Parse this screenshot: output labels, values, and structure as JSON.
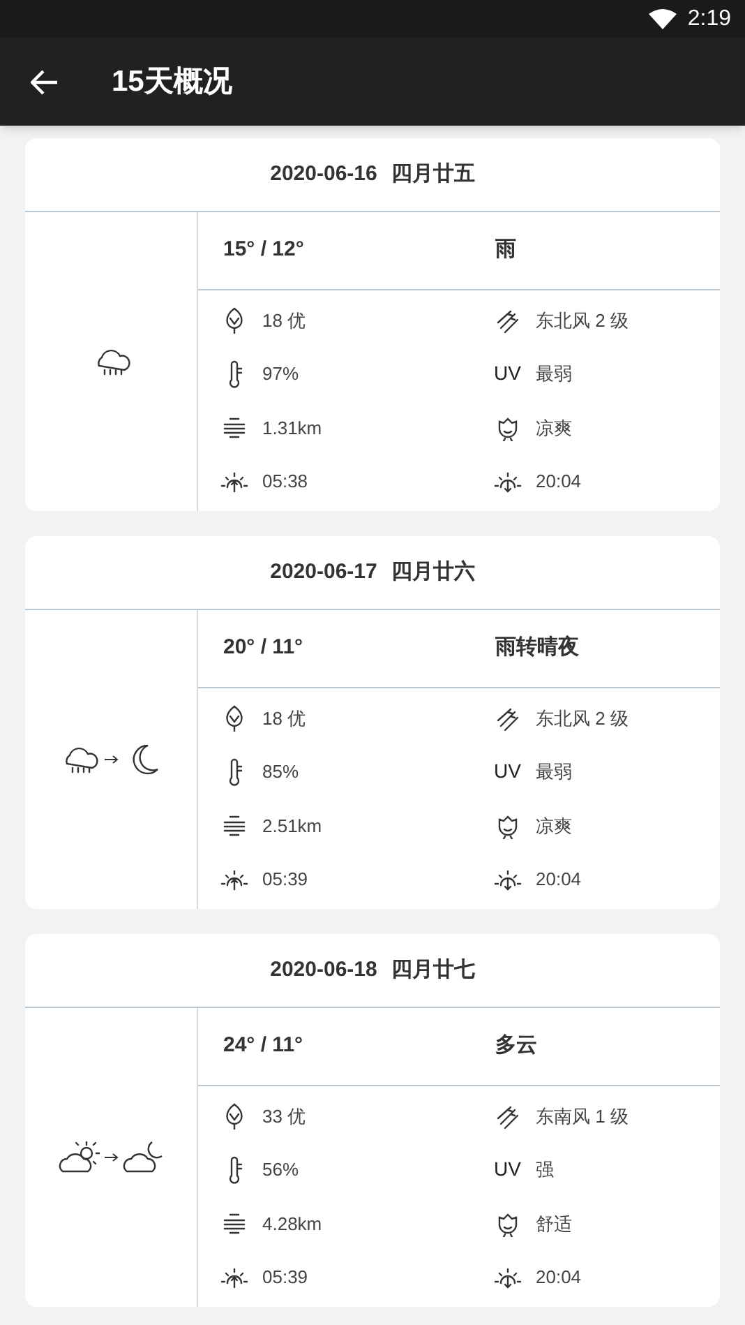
{
  "status_bar": {
    "time": "2:19"
  },
  "app_bar": {
    "title": "15天概况"
  },
  "days": [
    {
      "date": "2020-06-16",
      "lunar": "四月廿五",
      "weather_icons": [
        {
          "kind": "rain"
        }
      ],
      "temps": "15° / 12°",
      "condition": "雨",
      "details": [
        {
          "kind": "aqi",
          "value": "18 优"
        },
        {
          "kind": "wind",
          "value": "东北风 2 级"
        },
        {
          "kind": "humidity",
          "value": "97%"
        },
        {
          "kind": "uv",
          "label": "UV",
          "value": "最弱"
        },
        {
          "kind": "visibility",
          "value": "1.31km"
        },
        {
          "kind": "comfort",
          "value": "凉爽"
        },
        {
          "kind": "sunrise",
          "value": "05:38"
        },
        {
          "kind": "sunset",
          "value": "20:04"
        }
      ]
    },
    {
      "date": "2020-06-17",
      "lunar": "四月廿六",
      "weather_icons": [
        {
          "kind": "rain"
        },
        {
          "kind": "moon"
        }
      ],
      "temps": "20° / 11°",
      "condition": "雨转晴夜",
      "details": [
        {
          "kind": "aqi",
          "value": "18 优"
        },
        {
          "kind": "wind",
          "value": "东北风 2 级"
        },
        {
          "kind": "humidity",
          "value": "85%"
        },
        {
          "kind": "uv",
          "label": "UV",
          "value": "最弱"
        },
        {
          "kind": "visibility",
          "value": "2.51km"
        },
        {
          "kind": "comfort",
          "value": "凉爽"
        },
        {
          "kind": "sunrise",
          "value": "05:39"
        },
        {
          "kind": "sunset",
          "value": "20:04"
        }
      ]
    },
    {
      "date": "2020-06-18",
      "lunar": "四月廿七",
      "weather_icons": [
        {
          "kind": "cloud-sun"
        },
        {
          "kind": "cloud-moon"
        }
      ],
      "temps": "24° / 11°",
      "condition": "多云",
      "details": [
        {
          "kind": "aqi",
          "value": "33 优"
        },
        {
          "kind": "wind",
          "value": "东南风 1 级"
        },
        {
          "kind": "humidity",
          "value": "56%"
        },
        {
          "kind": "uv",
          "label": "UV",
          "value": "强"
        },
        {
          "kind": "visibility",
          "value": "4.28km"
        },
        {
          "kind": "comfort",
          "value": "舒适"
        },
        {
          "kind": "sunrise",
          "value": "05:39"
        },
        {
          "kind": "sunset",
          "value": "20:04"
        }
      ]
    }
  ]
}
